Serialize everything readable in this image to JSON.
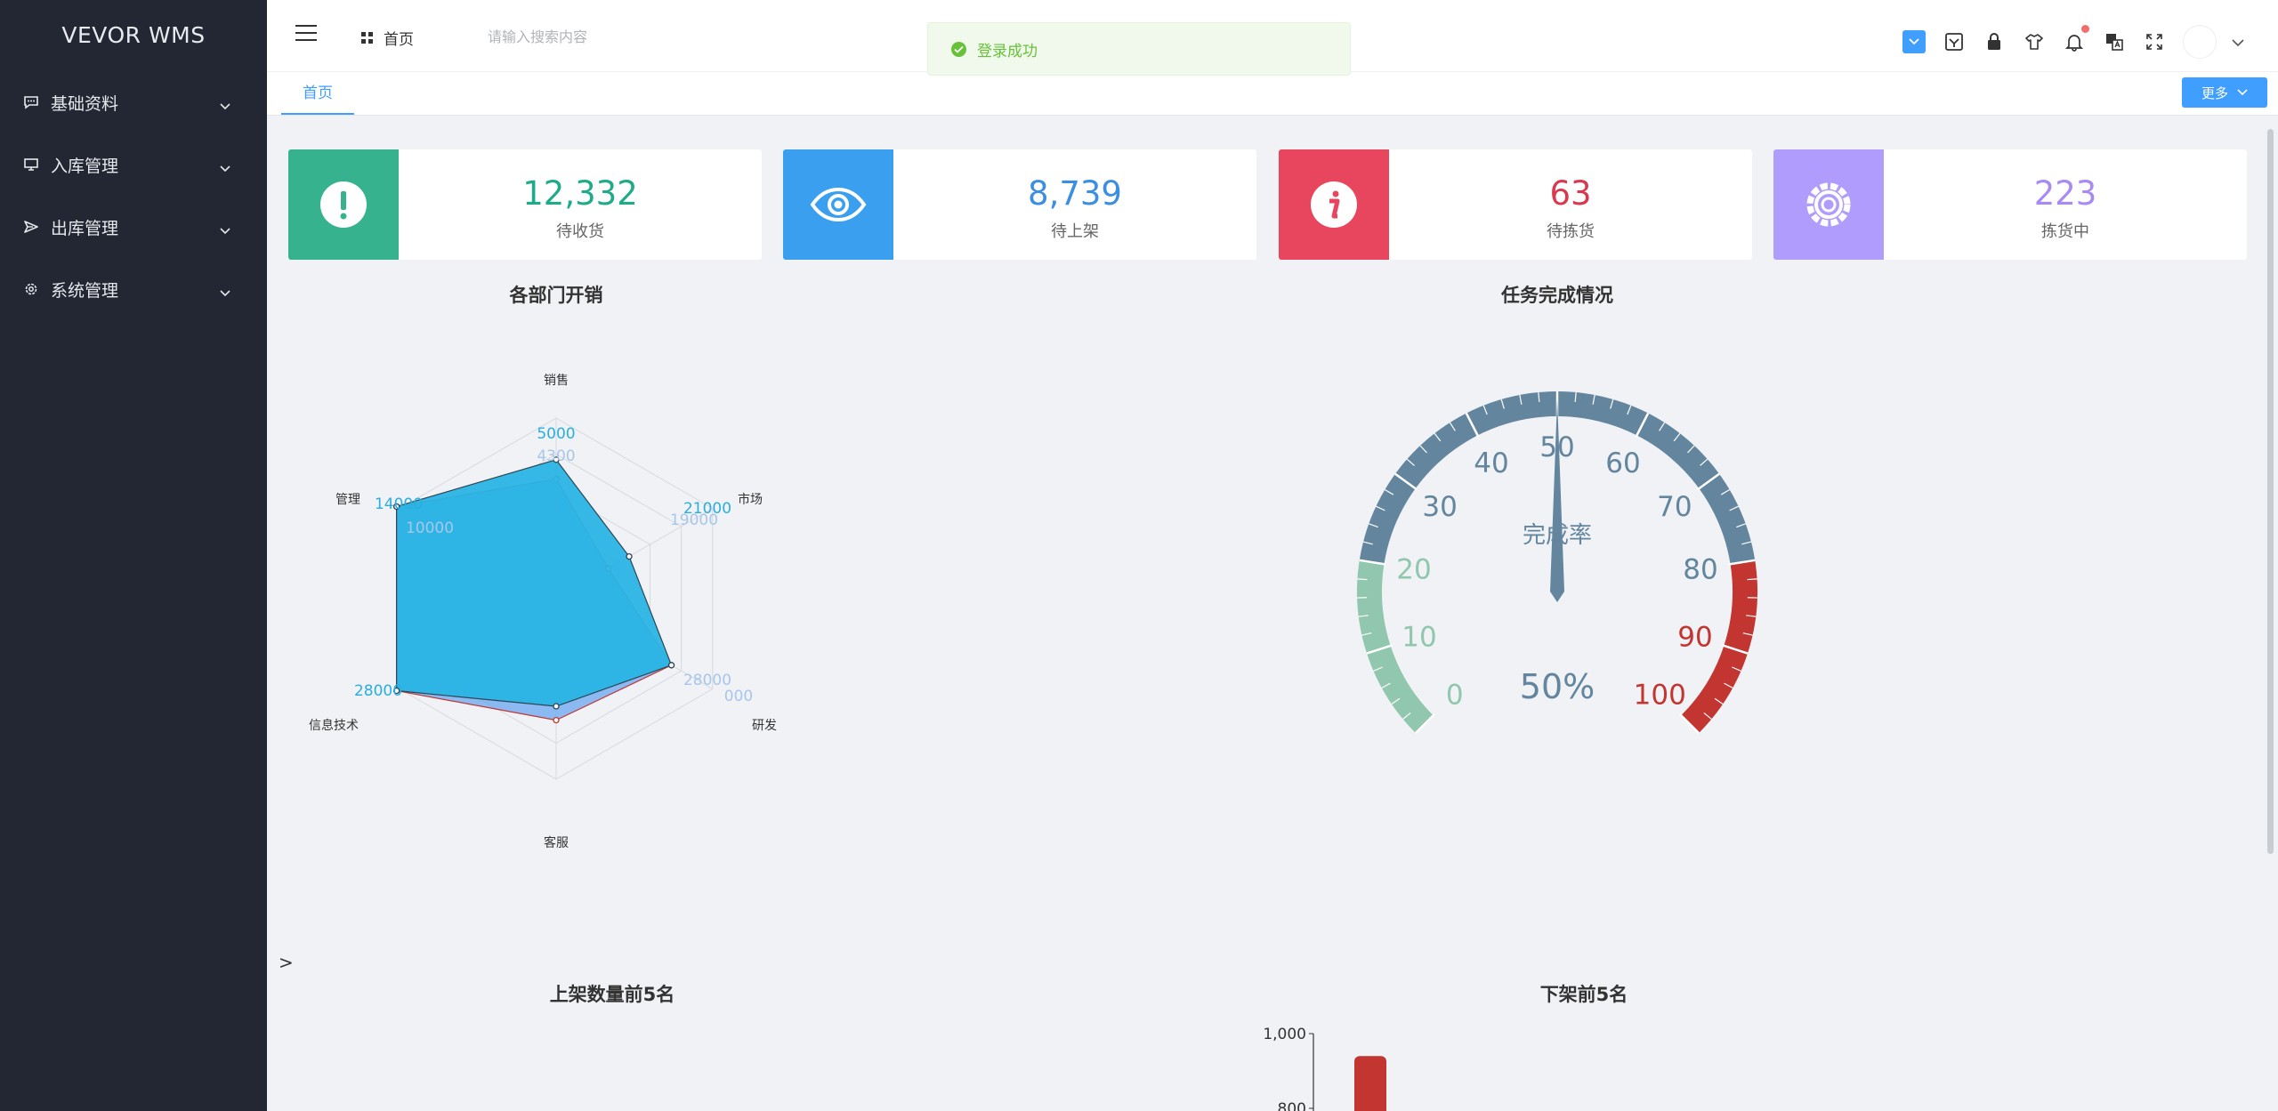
{
  "app": {
    "logo": "VEVOR WMS"
  },
  "sidebar": {
    "items": [
      {
        "label": "基础资料",
        "icon": "message-icon"
      },
      {
        "label": "入库管理",
        "icon": "monitor-icon"
      },
      {
        "label": "出库管理",
        "icon": "send-icon"
      },
      {
        "label": "系统管理",
        "icon": "gear-icon"
      }
    ]
  },
  "header": {
    "home_label": "首页",
    "search_placeholder": "请输入搜索内容",
    "toast": "登录成功"
  },
  "tabs": {
    "home": "首页",
    "more": "更多"
  },
  "cards": [
    {
      "value": "12,332",
      "label": "待收货",
      "color": "#36b38e",
      "text_color": "#1fab89",
      "icon": "exclamation-icon"
    },
    {
      "value": "8,739",
      "label": "待上架",
      "color": "#3b9ff0",
      "text_color": "#3b8ee0",
      "icon": "eye-icon"
    },
    {
      "value": "63",
      "label": "待拣货",
      "color": "#e8465e",
      "text_color": "#d9384f",
      "icon": "info-icon"
    },
    {
      "value": "223",
      "label": "拣货中",
      "color": "#b09cfc",
      "text_color": "#a88af5",
      "icon": "gear-icon"
    }
  ],
  "sections": {
    "radar_title": "各部门开销",
    "gauge_title": "任务完成情况",
    "bottom_left_title": "上架数量前5名",
    "bottom_right_title": "下架前5名",
    "stray_char": ">"
  },
  "chart_data": [
    {
      "type": "radar",
      "title": "各部门开销",
      "indicators": [
        "销售",
        "市场",
        "研发",
        "客服",
        "信息技术",
        "管理"
      ],
      "series": [
        {
          "values": [
            4300,
            10000,
            28000,
            35000,
            50000,
            19000
          ],
          "color": "#6aa6f0"
        },
        {
          "values": [
            5000,
            14000,
            28000,
            31000,
            42000,
            21000
          ],
          "color": "#2ab4e4"
        }
      ],
      "visible_labels": [
        "5000",
        "4300",
        "21000",
        "19000",
        "14000",
        "10000",
        "28000",
        "28000",
        "000",
        "000"
      ]
    },
    {
      "type": "gauge",
      "title": "任务完成情况",
      "name": "完成率",
      "value": 50,
      "value_label": "50%",
      "min": 0,
      "max": 100,
      "ticks": [
        "0",
        "10",
        "20",
        "30",
        "40",
        "50",
        "60",
        "70",
        "80",
        "90",
        "100"
      ],
      "bands": [
        {
          "to": 0.2,
          "color": "#91c7ae"
        },
        {
          "to": 0.8,
          "color": "#63869e"
        },
        {
          "to": 1.0,
          "color": "#c23531"
        }
      ]
    },
    {
      "type": "bar",
      "title": "下架前5名",
      "y_ticks": [
        "1,000",
        "800"
      ],
      "ylim": [
        0,
        1000
      ],
      "values": [
        940
      ],
      "color": "#c23531"
    }
  ]
}
